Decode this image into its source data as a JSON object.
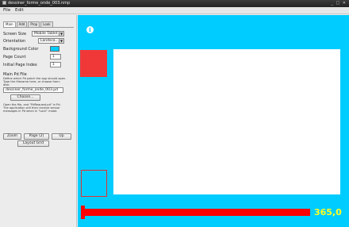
{
  "window": {
    "title": "dessiner_forme_onde_003.nmp",
    "controls": "_ □ ✕"
  },
  "menu": [
    "File",
    "Edit"
  ],
  "tabs": [
    "Main",
    "Add",
    "Prop",
    "Look"
  ],
  "settings": {
    "screen_size_label": "Screen Size",
    "screen_size_value": "Mobile Tablet...",
    "orientation_label": "Orientation",
    "orientation_value": "Landsca...",
    "background_color_label": "Background Color",
    "background_color": "#00ccff",
    "page_count_label": "Page Count",
    "page_count_value": "1",
    "initial_page_label": "Initial Page Index",
    "initial_page_value": "1"
  },
  "main_file": {
    "heading": "Main Pd File",
    "help1": "Define which Pd patch the app should open.",
    "help2": "Type the filename here, or choose from:",
    "help3": "disk:",
    "filename": "dessiner_forme_onde_003.pd",
    "choose_label": "Choose...",
    "note1": "Open the file, and \"PdRequest.pd\" in Pd.",
    "note2": "The application will then receive sensor",
    "note3": "messages in Pd when in \"Lock\" mode."
  },
  "bottom": {
    "zoom_label": "Zoom",
    "page_label": "Page (2)",
    "up_label": "Up",
    "layout_grid_label": "Layout Grid"
  },
  "canvas": {
    "bg_color": "#00ccff",
    "info_glyph": "i",
    "progress_value": "365,0",
    "accent_red": "#ff0000",
    "value_color": "#ffff22"
  }
}
